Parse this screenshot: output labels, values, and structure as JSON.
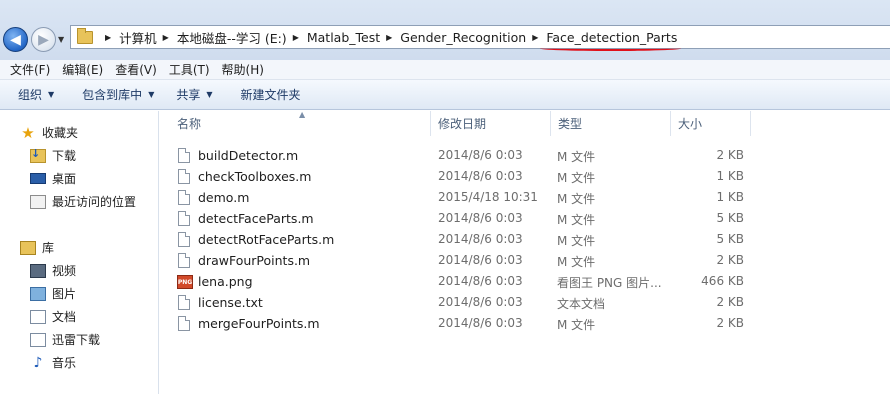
{
  "address_bar": {
    "breadcrumbs": [
      "计算机",
      "本地磁盘--学习 (E:)",
      "Matlab_Test",
      "Gender_Recognition",
      "Face_detection_Parts"
    ]
  },
  "menu": [
    "文件(F)",
    "编辑(E)",
    "查看(V)",
    "工具(T)",
    "帮助(H)"
  ],
  "toolbar": {
    "organize": "组织",
    "include_in_library": "包含到库中",
    "share": "共享",
    "new_folder": "新建文件夹"
  },
  "nav_pane": {
    "favorites": {
      "label": "收藏夹",
      "items": [
        "下载",
        "桌面",
        "最近访问的位置"
      ]
    },
    "libraries": {
      "label": "库",
      "items": [
        "视频",
        "图片",
        "文档",
        "迅雷下载",
        "音乐"
      ]
    }
  },
  "columns": {
    "name": "名称",
    "date": "修改日期",
    "type": "类型",
    "size": "大小"
  },
  "files": [
    {
      "name": "buildDetector.m",
      "date": "2014/8/6 0:03",
      "type": "M 文件",
      "size": "2 KB",
      "icon": "m-file-icon"
    },
    {
      "name": "checkToolboxes.m",
      "date": "2014/8/6 0:03",
      "type": "M 文件",
      "size": "1 KB",
      "icon": "m-file-icon"
    },
    {
      "name": "demo.m",
      "date": "2015/4/18 10:31",
      "type": "M 文件",
      "size": "1 KB",
      "icon": "m-file-icon"
    },
    {
      "name": "detectFaceParts.m",
      "date": "2014/8/6 0:03",
      "type": "M 文件",
      "size": "5 KB",
      "icon": "m-file-icon"
    },
    {
      "name": "detectRotFaceParts.m",
      "date": "2014/8/6 0:03",
      "type": "M 文件",
      "size": "5 KB",
      "icon": "m-file-icon"
    },
    {
      "name": "drawFourPoints.m",
      "date": "2014/8/6 0:03",
      "type": "M 文件",
      "size": "2 KB",
      "icon": "m-file-icon"
    },
    {
      "name": "lena.png",
      "date": "2014/8/6 0:03",
      "type": "看图王 PNG 图片...",
      "size": "466 KB",
      "icon": "png-file-icon"
    },
    {
      "name": "license.txt",
      "date": "2014/8/6 0:03",
      "type": "文本文档",
      "size": "2 KB",
      "icon": "txt-file-icon"
    },
    {
      "name": "mergeFourPoints.m",
      "date": "2014/8/6 0:03",
      "type": "M 文件",
      "size": "2 KB",
      "icon": "m-file-icon"
    }
  ],
  "colors": {
    "address_underline": "#e0101a",
    "toolbar_text": "#1e3a66",
    "folder": "#e8c35a"
  }
}
